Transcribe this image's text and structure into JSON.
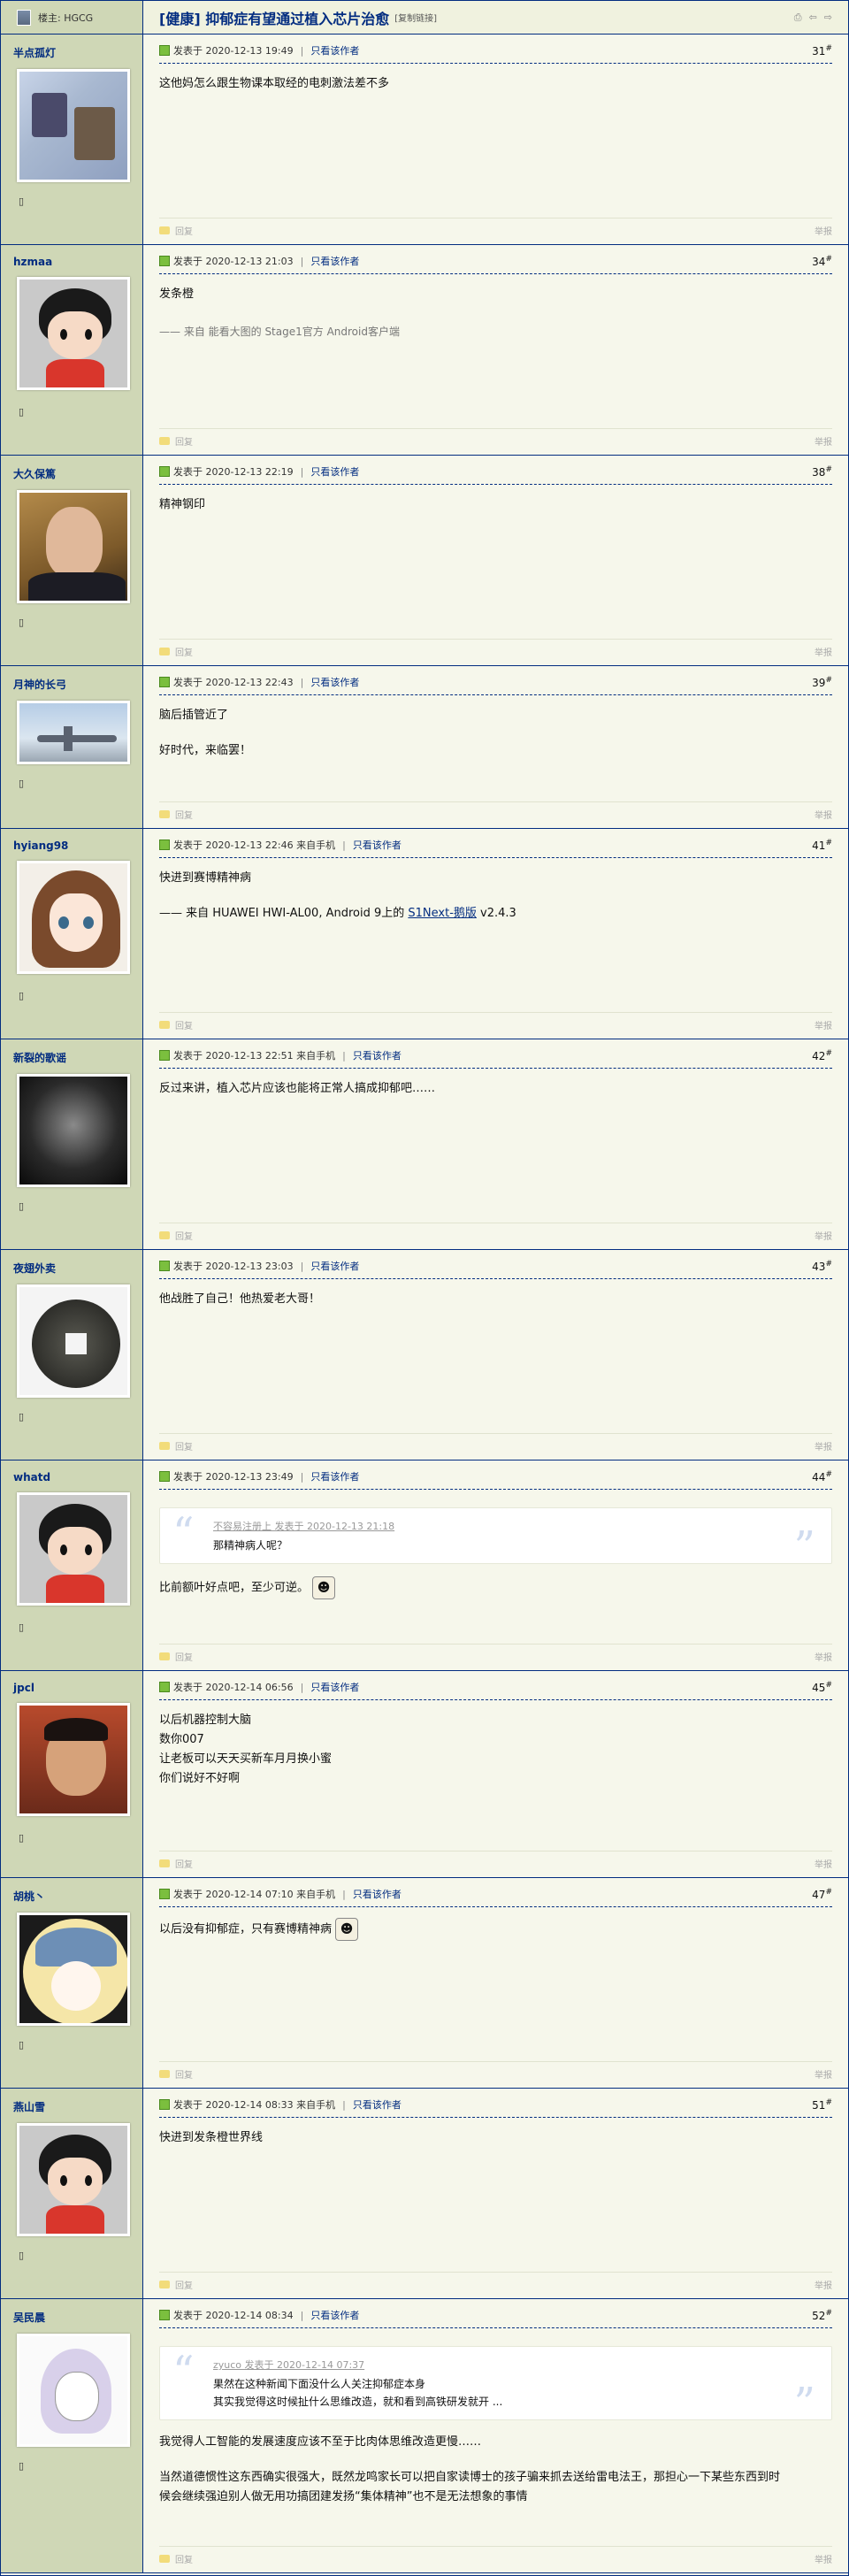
{
  "thread": {
    "master_label": "楼主: HGCG",
    "title": "[健康] 抑郁症有望通过植入芯片治愈",
    "copy_link": "[复制链接]"
  },
  "labels": {
    "posted_at": "发表于",
    "from_mobile": "来自手机",
    "only_author": "只看该作者",
    "reply": "回复",
    "report": "举报",
    "floor_suffix": "#"
  },
  "posts": [
    {
      "user": "半点孤灯",
      "time": "2020-12-13 19:49",
      "mobile": false,
      "floor": "31",
      "lines": [
        "这他妈怎么跟生物课本取经的电刺激法差不多"
      ]
    },
    {
      "user": "hzmaa",
      "time": "2020-12-13 21:03",
      "mobile": false,
      "floor": "34",
      "lines": [
        "发条橙"
      ],
      "sig": "—— 来自 能看大图的 Stage1官方 Android客户端"
    },
    {
      "user": "大久保篤",
      "time": "2020-12-13 22:19",
      "mobile": false,
      "floor": "38",
      "lines": [
        "精神钢印"
      ]
    },
    {
      "user": "月神的长弓",
      "time": "2020-12-13 22:43",
      "mobile": false,
      "floor": "39",
      "lines": [
        "脑后插管近了",
        "",
        "好时代，来临罢！"
      ]
    },
    {
      "user": "hyiang98",
      "time": "2020-12-13 22:46",
      "mobile": true,
      "floor": "41",
      "lines": [
        "快进到赛博精神病",
        ""
      ],
      "sig_pre": "—— 来自 HUAWEI HWI-AL00, Android 9上的 ",
      "sig_link": "S1Next-鹅版",
      "sig_post": " v2.4.3"
    },
    {
      "user": "新裂的歌谣",
      "time": "2020-12-13 22:51",
      "mobile": true,
      "floor": "42",
      "lines": [
        "反过来讲，植入芯片应该也能将正常人搞成抑郁吧……"
      ]
    },
    {
      "user": "夜翅外卖",
      "time": "2020-12-13 23:03",
      "mobile": false,
      "floor": "43",
      "lines": [
        "他战胜了自己！他热爱老大哥！"
      ]
    },
    {
      "user": "whatd",
      "time": "2020-12-13 23:49",
      "mobile": false,
      "floor": "44",
      "quote_src": "不容易注册上 发表于 2020-12-13 21:18",
      "quote_lines": [
        "那精神病人呢？"
      ],
      "lines": [
        "比前额叶好点吧，至少可逆。"
      ],
      "emoji_after": true
    },
    {
      "user": "jpcl",
      "time": "2020-12-14 06:56",
      "mobile": false,
      "floor": "45",
      "lines": [
        "以后机器控制大脑",
        "数你007",
        "让老板可以天天买新车月月换小蜜",
        "你们说好不好啊"
      ]
    },
    {
      "user": "胡桃丶",
      "time": "2020-12-14 07:10",
      "mobile": true,
      "floor": "47",
      "lines": [
        "以后没有抑郁症，只有赛博精神病"
      ],
      "emoji_after": true
    },
    {
      "user": "燕山雪",
      "time": "2020-12-14 08:33",
      "mobile": true,
      "floor": "51",
      "lines": [
        "快进到发条橙世界线"
      ]
    },
    {
      "user": "吴民晨",
      "time": "2020-12-14 08:34",
      "mobile": false,
      "floor": "52",
      "quote_src": "zyuco 发表于 2020-12-14 07:37",
      "quote_lines": [
        "果然在这种新闻下面没什么人关注抑郁症本身",
        "其实我觉得这时候扯什么思维改造，就和看到高铁研发就开 ..."
      ],
      "lines": [
        "我觉得人工智能的发展速度应该不至于比肉体思维改造更慢……",
        "",
        "当然道德惯性这东西确实很强大，既然龙鸣家长可以把自家读博士的孩子骗来抓去送给雷电法王，那担心一下某些东西到时",
        "候会继续强迫别人做无用功搞团建发扬“集体精神”也不是无法想象的事情"
      ]
    }
  ],
  "colors": {
    "border": "#022c80",
    "sidebar": "#cfd7b6",
    "content_bg": "#f6f7eb",
    "link": "#022c80"
  }
}
